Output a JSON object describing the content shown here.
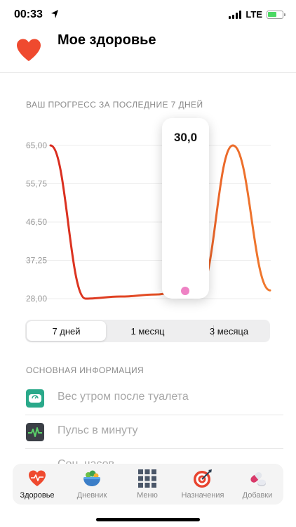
{
  "status_bar": {
    "time": "00:33",
    "network": "LTE"
  },
  "header": {
    "title": "Мое здоровье"
  },
  "progress": {
    "label": "ВАШ ПРОГРЕСС ЗА ПОСЛЕДНИЕ 7 ДНЕЙ",
    "tooltip_value": "30,0"
  },
  "colors": {
    "accent": "#e8442f",
    "line_start": "#d92b1f",
    "line_end": "#f07a2e",
    "tooltip_dot": "#ee82c4"
  },
  "chart_data": {
    "type": "line",
    "y_ticks": [
      "65,00",
      "55,75",
      "46,50",
      "37,25",
      "28,00"
    ],
    "y_tick_values": [
      65.0,
      55.75,
      46.5,
      37.25,
      28.0
    ],
    "ylim": [
      28.0,
      65.0
    ],
    "series": [
      {
        "values": [
          65.0,
          28.0,
          28.5,
          29.0,
          30.0,
          30.0,
          65.0,
          30.0
        ]
      }
    ],
    "highlight_index": 5,
    "grid": "horizontal"
  },
  "range_selector": {
    "options": [
      "7 дней",
      "1 месяц",
      "3 месяца"
    ],
    "selected": "7 дней"
  },
  "info": {
    "label": "ОСНОВНАЯ ИНФОРМАЦИЯ",
    "items": [
      {
        "label": "Вес утром после туалета",
        "icon": "scale-icon"
      },
      {
        "label": "Пульс в минуту",
        "icon": "pulse-icon"
      },
      {
        "label": "Сон, часов",
        "icon": "sleep-icon"
      }
    ]
  },
  "tabs": [
    {
      "label": "Здоровье",
      "icon": "heart-pulse-icon",
      "active": true
    },
    {
      "label": "Дневник",
      "icon": "food-bowl-icon",
      "active": false
    },
    {
      "label": "Меню",
      "icon": "grid-icon",
      "active": false
    },
    {
      "label": "Назначения",
      "icon": "target-icon",
      "active": false
    },
    {
      "label": "Добавки",
      "icon": "pills-icon",
      "active": false
    }
  ]
}
